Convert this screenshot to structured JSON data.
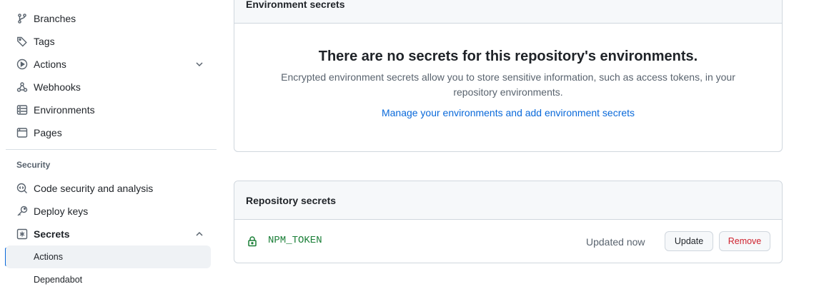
{
  "sidebar": {
    "items": [
      {
        "label": "Branches",
        "icon": "git-branch-icon"
      },
      {
        "label": "Tags",
        "icon": "tag-icon"
      },
      {
        "label": "Actions",
        "icon": "play-icon"
      },
      {
        "label": "Webhooks",
        "icon": "webhook-icon"
      },
      {
        "label": "Environments",
        "icon": "server-icon"
      },
      {
        "label": "Pages",
        "icon": "browser-icon"
      }
    ],
    "security_section_title": "Security",
    "security_items": [
      {
        "label": "Code security and analysis",
        "icon": "codescan-icon"
      },
      {
        "label": "Deploy keys",
        "icon": "key-icon"
      },
      {
        "label": "Secrets",
        "icon": "asterisk-icon"
      }
    ],
    "secrets_sub_items": [
      {
        "label": "Actions",
        "active": true
      },
      {
        "label": "Dependabot",
        "active": false
      }
    ]
  },
  "environment_secrets": {
    "header": "Environment secrets",
    "blank_title": "There are no secrets for this repository's environments.",
    "blank_description": "Encrypted environment secrets allow you to store sensitive information, such as access tokens, in your repository environments.",
    "link_text": "Manage your environments and add environment secrets"
  },
  "repository_secrets": {
    "header": "Repository secrets",
    "secrets": [
      {
        "name": "NPM_TOKEN",
        "updated": "Updated now",
        "update_label": "Update",
        "remove_label": "Remove"
      }
    ]
  },
  "colors": {
    "accent": "#0969da",
    "secret_name": "#1a7f37",
    "danger": "#cf222e"
  }
}
